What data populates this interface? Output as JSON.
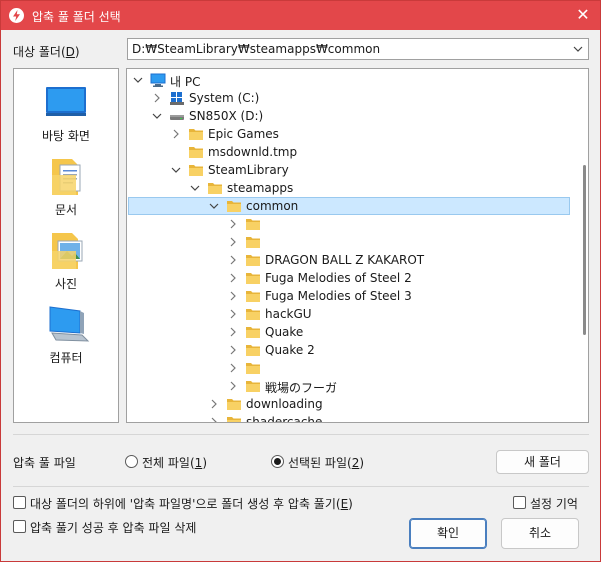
{
  "window": {
    "title": "압축 풀 폴더 선택",
    "close_glyph": "✕"
  },
  "target_folder": {
    "label": "대상 폴더(",
    "accel": "D",
    "label_end": ")",
    "value": "D:₩SteamLibrary₩steamapps₩common"
  },
  "places": [
    {
      "label": "바탕 화면",
      "icon": "desktop-icon"
    },
    {
      "label": "문서",
      "icon": "documents-icon"
    },
    {
      "label": "사진",
      "icon": "pictures-icon"
    },
    {
      "label": "컴퓨터",
      "icon": "computer-icon"
    }
  ],
  "tree": [
    {
      "label": "내 PC",
      "depth": 0,
      "expand": "open",
      "icon": "pc"
    },
    {
      "label": "System (C:)",
      "depth": 1,
      "expand": "closed",
      "icon": "drive-c"
    },
    {
      "label": "SN850X (D:)",
      "depth": 1,
      "expand": "open",
      "icon": "drive"
    },
    {
      "label": "Epic Games",
      "depth": 2,
      "expand": "closed",
      "icon": "folder"
    },
    {
      "label": "msdownld.tmp",
      "depth": 2,
      "expand": "none",
      "icon": "folder"
    },
    {
      "label": "SteamLibrary",
      "depth": 2,
      "expand": "open",
      "icon": "folder"
    },
    {
      "label": "steamapps",
      "depth": 3,
      "expand": "open",
      "icon": "folder"
    },
    {
      "label": "common",
      "depth": 4,
      "expand": "open",
      "icon": "folder",
      "selected": true
    },
    {
      "label": "",
      "depth": 5,
      "expand": "closed",
      "icon": "folder"
    },
    {
      "label": "",
      "depth": 5,
      "expand": "closed",
      "icon": "folder"
    },
    {
      "label": "DRAGON BALL Z KAKAROT",
      "depth": 5,
      "expand": "closed",
      "icon": "folder"
    },
    {
      "label": "Fuga Melodies of Steel 2",
      "depth": 5,
      "expand": "closed",
      "icon": "folder"
    },
    {
      "label": "Fuga Melodies of Steel 3",
      "depth": 5,
      "expand": "closed",
      "icon": "folder"
    },
    {
      "label": "hackGU",
      "depth": 5,
      "expand": "closed",
      "icon": "folder"
    },
    {
      "label": "Quake",
      "depth": 5,
      "expand": "closed",
      "icon": "folder"
    },
    {
      "label": "Quake 2",
      "depth": 5,
      "expand": "closed",
      "icon": "folder"
    },
    {
      "label": "",
      "depth": 5,
      "expand": "closed",
      "icon": "folder"
    },
    {
      "label": "戦場のフーガ",
      "depth": 5,
      "expand": "closed",
      "icon": "folder"
    },
    {
      "label": "downloading",
      "depth": 4,
      "expand": "closed",
      "icon": "folder"
    },
    {
      "label": "shadercache",
      "depth": 4,
      "expand": "closed",
      "icon": "folder"
    }
  ],
  "extract_files": {
    "label": "압축 풀 파일",
    "all": {
      "label": "전체 파일(",
      "accel": "1",
      "end": ")",
      "checked": false
    },
    "selected": {
      "label": "선택된 파일(",
      "accel": "2",
      "end": ")",
      "checked": true
    }
  },
  "new_folder_button": "새 폴더",
  "options": {
    "create_subfolder": {
      "label": "대상 폴더의 하위에 '압축 파일명'으로 폴더 생성 후 압축 풀기(",
      "accel": "E",
      "end": ")",
      "checked": false
    },
    "delete_after": {
      "label": "압축 풀기 성공 후 압축 파일 삭제",
      "checked": false
    },
    "remember": {
      "label": "설정 기억",
      "checked": false
    }
  },
  "ok_button": "확인",
  "cancel_button": "취소"
}
